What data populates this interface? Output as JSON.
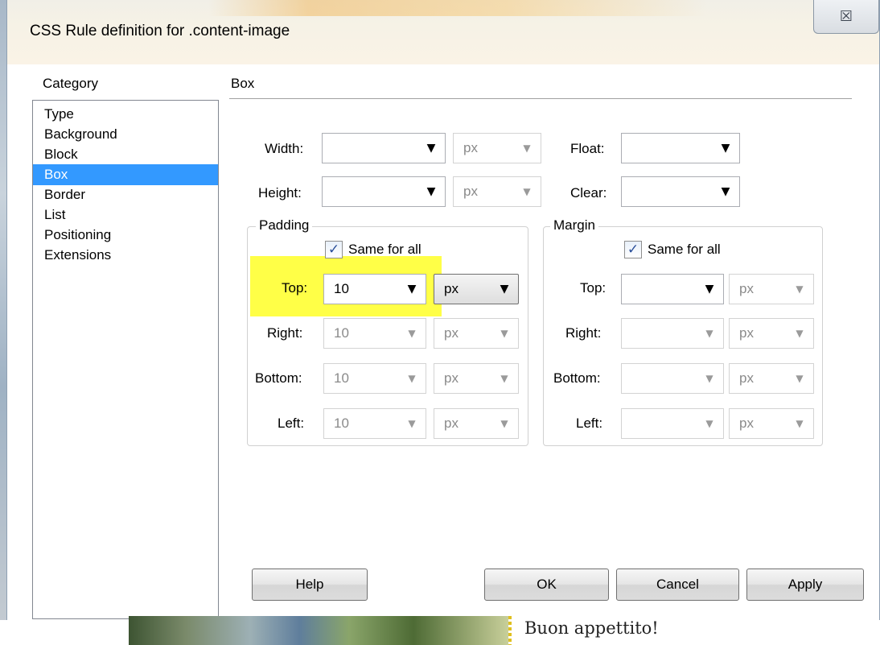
{
  "window": {
    "title": "CSS Rule definition for .content-image",
    "close_label": "☒"
  },
  "category": {
    "header": "Category",
    "items": [
      "Type",
      "Background",
      "Block",
      "Box",
      "Border",
      "List",
      "Positioning",
      "Extensions"
    ],
    "selected": "Box"
  },
  "section": {
    "title": "Box"
  },
  "fields": {
    "width": {
      "label": "Width:",
      "value": "",
      "unit": "px"
    },
    "height": {
      "label": "Height:",
      "value": "",
      "unit": "px"
    },
    "float": {
      "label": "Float:",
      "value": ""
    },
    "clear": {
      "label": "Clear:",
      "value": ""
    }
  },
  "padding": {
    "title": "Padding",
    "same_for_all_label": "Same for all",
    "same_for_all_checked": true,
    "top": {
      "label": "Top:",
      "value": "10",
      "unit": "px"
    },
    "right": {
      "label": "Right:",
      "value": "10",
      "unit": "px"
    },
    "bottom": {
      "label": "Bottom:",
      "value": "10",
      "unit": "px"
    },
    "left": {
      "label": "Left:",
      "value": "10",
      "unit": "px"
    }
  },
  "margin": {
    "title": "Margin",
    "same_for_all_label": "Same for all",
    "same_for_all_checked": true,
    "top": {
      "label": "Top:",
      "value": "",
      "unit": "px"
    },
    "right": {
      "label": "Right:",
      "value": "",
      "unit": "px"
    },
    "bottom": {
      "label": "Bottom:",
      "value": "",
      "unit": "px"
    },
    "left": {
      "label": "Left:",
      "value": "",
      "unit": "px"
    }
  },
  "buttons": {
    "help": "Help",
    "ok": "OK",
    "cancel": "Cancel",
    "apply": "Apply"
  },
  "background_page": {
    "caption": "Buon appettito!"
  },
  "icons": {
    "check": "✓",
    "arrow": "▼"
  },
  "colors": {
    "selection": "#3399ff",
    "highlight": "#ffff33"
  }
}
